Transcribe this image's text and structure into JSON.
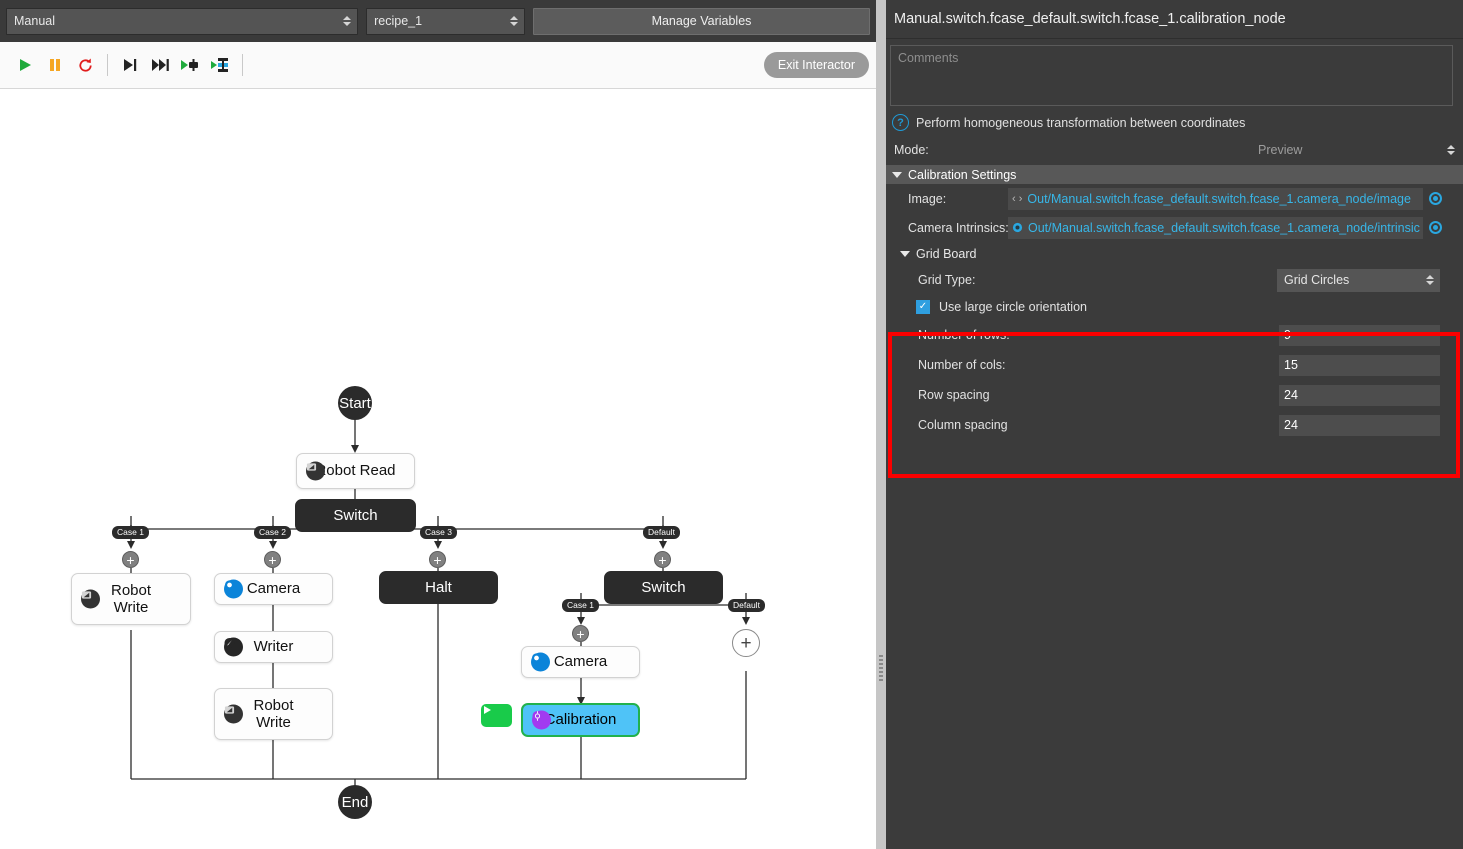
{
  "top_bar": {
    "mode_select": "Manual",
    "recipe_select": "recipe_1",
    "manage_variables_label": "Manage Variables"
  },
  "toolbar": {
    "buttons": [
      {
        "name": "run-button",
        "icon": "play-icon"
      },
      {
        "name": "pause-button",
        "icon": "pause-icon"
      },
      {
        "name": "reset-button",
        "icon": "refresh-icon"
      },
      {
        "name": "step-into-button",
        "icon": "step-into-icon"
      },
      {
        "name": "step-over-button",
        "icon": "step-over-icon"
      },
      {
        "name": "run-to-node-button",
        "icon": "run-to-node-icon"
      },
      {
        "name": "run-from-node-button",
        "icon": "run-from-node-icon"
      }
    ],
    "exit_interactor_label": "Exit Interactor"
  },
  "flow": {
    "start_label": "Start",
    "end_label": "End",
    "nodes": [
      {
        "id": "robot_read",
        "label": "Robot Read",
        "icon": "robot-icon",
        "style": "light"
      },
      {
        "id": "switch_top",
        "label": "Switch",
        "icon": "none",
        "style": "dark"
      },
      {
        "id": "robot_write_1",
        "label": "Robot\nWrite",
        "icon": "robot-icon",
        "style": "light"
      },
      {
        "id": "camera_1",
        "label": "Camera",
        "icon": "camera-icon",
        "style": "light"
      },
      {
        "id": "writer",
        "label": "Writer",
        "icon": "writer-icon",
        "style": "light"
      },
      {
        "id": "robot_write_2",
        "label": "Robot\nWrite",
        "icon": "robot-icon",
        "style": "light"
      },
      {
        "id": "halt",
        "label": "Halt",
        "icon": "none",
        "style": "dark"
      },
      {
        "id": "switch_nested",
        "label": "Switch",
        "icon": "none",
        "style": "dark"
      },
      {
        "id": "camera_2",
        "label": "Camera",
        "icon": "camera-icon",
        "style": "light"
      },
      {
        "id": "calibration",
        "label": "Calibration",
        "icon": "calibration-icon",
        "style": "selected"
      }
    ],
    "branch_labels": {
      "case1": "Case 1",
      "case2": "Case 2",
      "case3": "Case 3",
      "default": "Default",
      "nested_default": "Default",
      "nested_case1": "Case 1",
      "nested_default2": "Default"
    },
    "add_node_glyph": "+",
    "run_node_glyph": "play-icon"
  },
  "inspector": {
    "node_path": "Manual.switch.fcase_default.switch.fcase_1.calibration_node",
    "comments_placeholder": "Comments",
    "description": "Perform homogeneous transformation between coordinates",
    "mode_label": "Mode:",
    "mode_value": "Preview",
    "calibration_settings_header": "Calibration Settings",
    "image_label": "Image:",
    "image_value": "Out/Manual.switch.fcase_default.switch.fcase_1.camera_node/image",
    "camera_intrinsics_label": "Camera Intrinsics:",
    "camera_intrinsics_value": "Out/Manual.switch.fcase_default.switch.fcase_1.camera_node/intrinsic",
    "grid_board_header": "Grid Board",
    "grid_type_label": "Grid Type:",
    "grid_type_value": "Grid Circles",
    "use_large_circle_label": "Use large circle orientation",
    "use_large_circle_checked": true,
    "fields": [
      {
        "label": "Number of rows:",
        "value": "9"
      },
      {
        "label": "Number of cols:",
        "value": "15"
      },
      {
        "label": "Row spacing",
        "value": "24"
      },
      {
        "label": "Column spacing",
        "value": "24"
      }
    ]
  },
  "colors": {
    "accent_blue": "#2aa7e0",
    "link_blue": "#37b6e8",
    "selection_cyan": "#4fc3f7",
    "selection_border_green": "#22b14c",
    "highlight_red": "#fb0000",
    "panel_bg": "#3b3b3b",
    "run_green": "#19cb4a"
  }
}
